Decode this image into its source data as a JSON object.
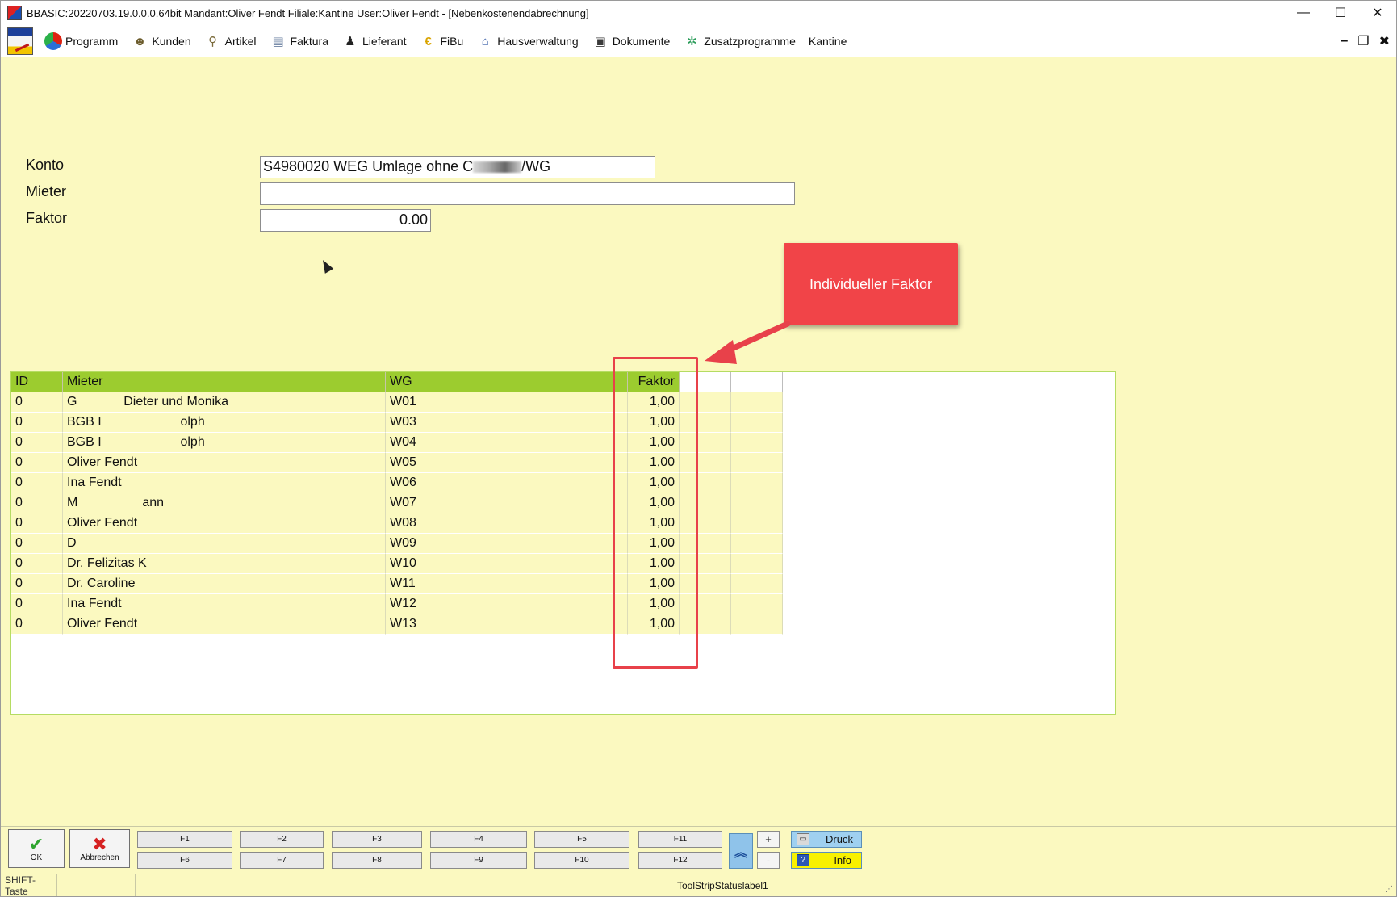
{
  "window": {
    "title": "BBASIC:20220703.19.0.0.0.64bit Mandant:Oliver Fendt Filiale:Kantine User:Oliver Fendt - [Nebenkostenendabrechnung]",
    "minimize": "—",
    "maximize": "☐",
    "close": "✕"
  },
  "menu": {
    "items": [
      {
        "label": "Programm",
        "icon": "programm-icon"
      },
      {
        "label": "Kunden",
        "icon": "kunden-icon"
      },
      {
        "label": "Artikel",
        "icon": "artikel-icon"
      },
      {
        "label": "Faktura",
        "icon": "faktura-icon"
      },
      {
        "label": "Lieferant",
        "icon": "lieferant-icon"
      },
      {
        "label": "FiBu",
        "icon": "euro-icon"
      },
      {
        "label": "Hausverwaltung",
        "icon": "house-icon"
      },
      {
        "label": "Dokumente",
        "icon": "dokumente-icon"
      },
      {
        "label": "Zusatzprogramme",
        "icon": "zusatz-icon"
      },
      {
        "label": "Kantine",
        "icon": ""
      }
    ],
    "mdi_minimize": "–",
    "mdi_restore": "❐",
    "mdi_close": "✖"
  },
  "form": {
    "konto_label": "Konto",
    "konto_value_prefix": "S4980020 WEG Umlage ohne C",
    "konto_value_suffix": "/WG",
    "mieter_label": "Mieter",
    "mieter_value": "",
    "faktor_label": "Faktor",
    "faktor_value": "0.00"
  },
  "callout": {
    "text": "Individueller Faktor",
    "color": "#f14448"
  },
  "grid": {
    "headers": [
      "ID",
      "Mieter",
      "WG",
      "Faktor"
    ],
    "header_color": "#9ccc2f",
    "rows": [
      {
        "id": "0",
        "mieter": "G             Dieter und Monika",
        "wg": "W01",
        "faktor": "1,00"
      },
      {
        "id": "0",
        "mieter": " BGB I                      olph",
        "wg": "W03",
        "faktor": "1,00"
      },
      {
        "id": "0",
        "mieter": " BGB I                      olph",
        "wg": "W04",
        "faktor": "1,00"
      },
      {
        "id": "0",
        "mieter": "Oliver Fendt",
        "wg": "W05",
        "faktor": "1,00"
      },
      {
        "id": "0",
        "mieter": "Ina Fendt",
        "wg": "W06",
        "faktor": "1,00"
      },
      {
        "id": "0",
        "mieter": "M                  ann",
        "wg": "W07",
        "faktor": "1,00"
      },
      {
        "id": "0",
        "mieter": "Oliver Fendt",
        "wg": "W08",
        "faktor": "1,00"
      },
      {
        "id": "0",
        "mieter": "D",
        "wg": "W09",
        "faktor": "1,00"
      },
      {
        "id": "0",
        "mieter": "Dr. Felizitas K",
        "wg": "W10",
        "faktor": "1,00"
      },
      {
        "id": "0",
        "mieter": "Dr. Caroline",
        "wg": "W11",
        "faktor": "1,00"
      },
      {
        "id": "0",
        "mieter": "Ina Fendt",
        "wg": "W12",
        "faktor": "1,00"
      },
      {
        "id": "0",
        "mieter": "Oliver Fendt",
        "wg": "W13",
        "faktor": "1,00"
      }
    ]
  },
  "buttons": {
    "ok": "OK",
    "abbrechen": "Abbrechen",
    "f1": "F1",
    "f2": "F2",
    "f3": "F3",
    "f4": "F4",
    "f5": "F5",
    "f11": "F11",
    "f6": "F6",
    "f7": "F7",
    "f8": "F8",
    "f9": "F9",
    "f10": "F10",
    "f12": "F12",
    "plus": "+",
    "minus": "-",
    "druck": "Druck",
    "info": "Info"
  },
  "status": {
    "left": "SHIFT-Taste",
    "label": "ToolStripStatuslabel1"
  }
}
